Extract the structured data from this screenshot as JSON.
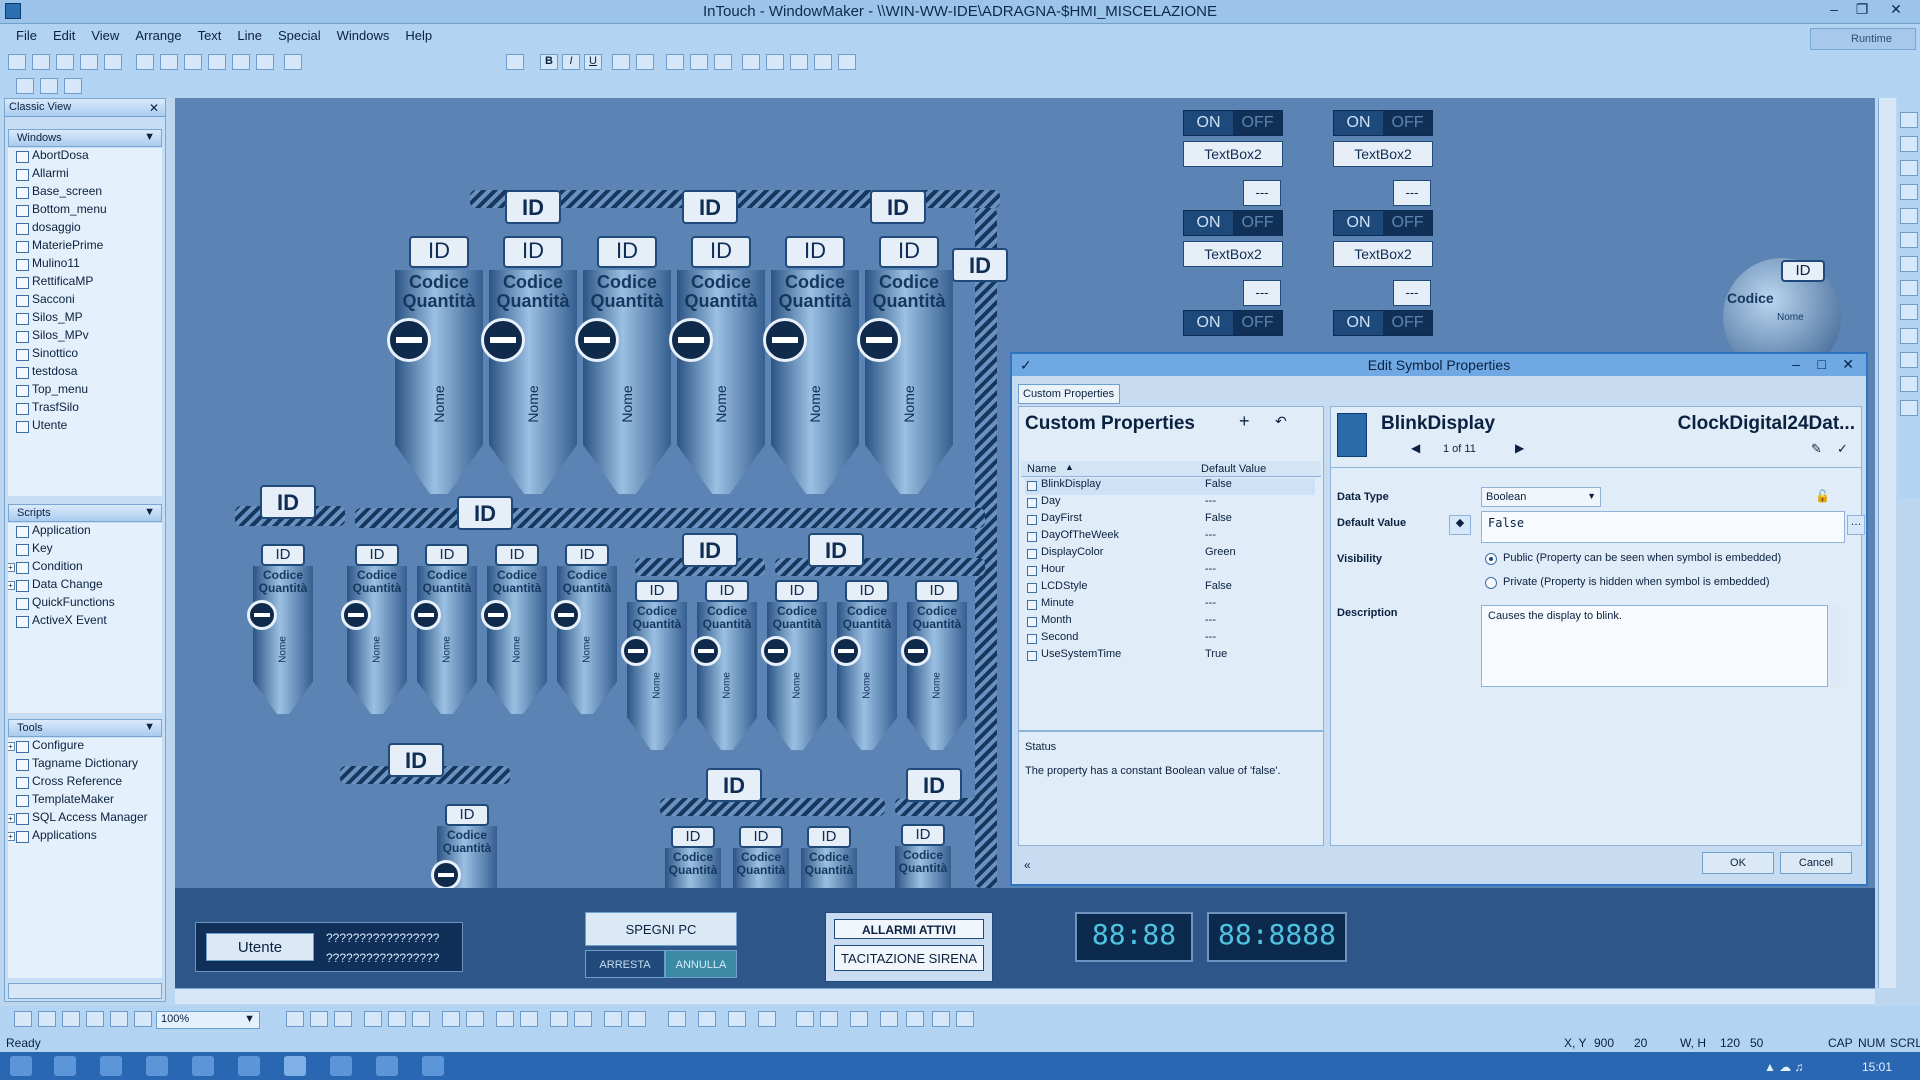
{
  "window": {
    "title": "InTouch - WindowMaker - \\\\WIN-WW-IDE\\ADRAGNA-$HMI_MISCELAZIONE",
    "runtime": "Runtime"
  },
  "menu": [
    "File",
    "Edit",
    "View",
    "Arrange",
    "Text",
    "Line",
    "Special",
    "Windows",
    "Help"
  ],
  "classic_view": {
    "title": "Classic View",
    "windows_header": "Windows",
    "windows": [
      "AbortDosa",
      "Allarmi",
      "Base_screen",
      "Bottom_menu",
      "dosaggio",
      "MateriePrime",
      "Mulino11",
      "RettificaMP",
      "Sacconi",
      "Silos_MP",
      "Silos_MPv",
      "Sinottico",
      "testdosa",
      "Top_menu",
      "TrasfSilo",
      "Utente"
    ],
    "scripts_header": "Scripts",
    "scripts": [
      "Application",
      "Key",
      "Condition",
      "Data Change",
      "QuickFunctions",
      "ActiveX Event"
    ],
    "tools_header": "Tools",
    "tools": [
      "Configure",
      "Tagname Dictionary",
      "Cross Reference",
      "TemplateMaker",
      "SQL Access Manager",
      "Applications"
    ]
  },
  "canvas": {
    "id": "ID",
    "codice": "Codice",
    "quantita": "Quantità",
    "nome": "Nome",
    "on": "ON",
    "off": "OFF",
    "textbox": "TextBox2",
    "dash": "---",
    "utente": "Utente",
    "qmarks": "?????????????????",
    "spegni": "SPEGNI PC",
    "arresta": "ARRESTA",
    "annulla": "ANNULLA",
    "allarmi": "ALLARMI ATTIVI",
    "tacitazione": "TACITAZIONE SIRENA",
    "lcd1": "88:88",
    "lcd2": "88:8888",
    "zoom": "100%"
  },
  "dialog": {
    "title": "Edit Symbol Properties",
    "tab": "Custom Properties",
    "heading": "Custom Properties",
    "col_name": "Name",
    "col_default": "Default Value",
    "properties": [
      {
        "name": "BlinkDisplay",
        "value": "False"
      },
      {
        "name": "Day",
        "value": "---"
      },
      {
        "name": "DayFirst",
        "value": "False"
      },
      {
        "name": "DayOfTheWeek",
        "value": "---"
      },
      {
        "name": "DisplayColor",
        "value": "Green"
      },
      {
        "name": "Hour",
        "value": "---"
      },
      {
        "name": "LCDStyle",
        "value": "False"
      },
      {
        "name": "Minute",
        "value": "---"
      },
      {
        "name": "Month",
        "value": "---"
      },
      {
        "name": "Second",
        "value": "---"
      },
      {
        "name": "UseSystemTime",
        "value": "True"
      }
    ],
    "status_label": "Status",
    "status_text": "The property has a constant Boolean value of 'false'.",
    "prop_name": "BlinkDisplay",
    "symbol_name": "ClockDigital24Dat...",
    "pager": "1 of 11",
    "data_type_label": "Data Type",
    "data_type": "Boolean",
    "default_value_label": "Default Value",
    "default_value": "False",
    "visibility_label": "Visibility",
    "public": "Public (Property can be seen when symbol is embedded)",
    "private": "Private (Property is hidden when symbol is embedded)",
    "description_label": "Description",
    "description": "Causes the display to blink.",
    "ok": "OK",
    "cancel": "Cancel"
  },
  "statusbar": {
    "ready": "Ready",
    "xy_label": "X, Y",
    "x": "900",
    "y": "20",
    "wh_label": "W, H",
    "w": "120",
    "h": "50",
    "cap": "CAP",
    "num": "NUM",
    "scrl": "SCRL"
  },
  "taskbar": {
    "time": "15:01"
  }
}
